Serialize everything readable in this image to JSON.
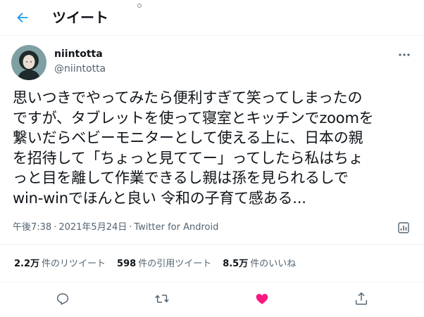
{
  "header": {
    "title": "ツイート"
  },
  "author": {
    "display_name": "niintotta",
    "handle": "@niintotta"
  },
  "tweet": {
    "text": "思いつきでやってみたら便利すぎて笑ってしまったの\nですが、タブレットを使って寝室とキッチンでzoomを\n繋いだらベビーモニターとして使える上に、日本の親\nを招待して「ちょっと見ててー」ってしたら私はちょ\nっと目を離して作業できるし親は孫を見られるしで\nwin-winでほんと良い 令和の子育て感ある...",
    "time": "午後7:38",
    "date": "2021年5月24日",
    "source": "Twitter for Android",
    "separator": "·"
  },
  "stats": {
    "retweets_count": "2.2万",
    "retweets_label": "件のリツイート",
    "quotes_count": "598",
    "quotes_label": "件の引用ツイート",
    "likes_count": "8.5万",
    "likes_label": "件のいいね"
  },
  "colors": {
    "accent": "#1d9bf0",
    "like": "#f91880",
    "secondary_text": "#536471",
    "divider": "#eff3f4"
  },
  "icons": {
    "back": "arrow-left-icon",
    "more": "more-horizontal-icon",
    "analytics": "analytics-icon",
    "reply": "reply-icon",
    "retweet": "retweet-icon",
    "like": "heart-icon",
    "share": "share-icon"
  }
}
